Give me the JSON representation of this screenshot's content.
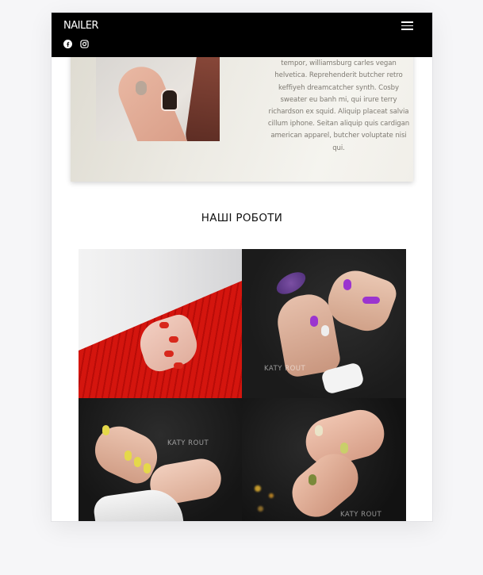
{
  "navbar": {
    "brand": "NAILER",
    "social": [
      {
        "icon": "facebook-icon"
      },
      {
        "icon": "instagram-icon"
      }
    ]
  },
  "about": {
    "text": "synth master cleanse. Mustache cliche tempor, williamsburg carles vegan helvetica. Reprehenderit butcher retro keffiyeh dreamcatcher synth. Cosby sweater eu banh mi, qui irure terry richardson ex squid. Aliquip placeat salvia cillum iphone. Seitan aliquip quis cardigan american apparel, butcher voluptate nisi qui."
  },
  "works": {
    "title": "НАШІ РОБОТИ",
    "items": [
      {
        "watermark": ""
      },
      {
        "watermark": "KATY ROUT"
      },
      {
        "watermark": "KATY ROUT"
      },
      {
        "watermark": "KATY ROUT"
      }
    ]
  },
  "colors": {
    "navbar_bg": "#000000",
    "accent_red": "#d4150e",
    "accent_purple": "#9b34cf",
    "accent_yellow": "#e5d84a"
  }
}
